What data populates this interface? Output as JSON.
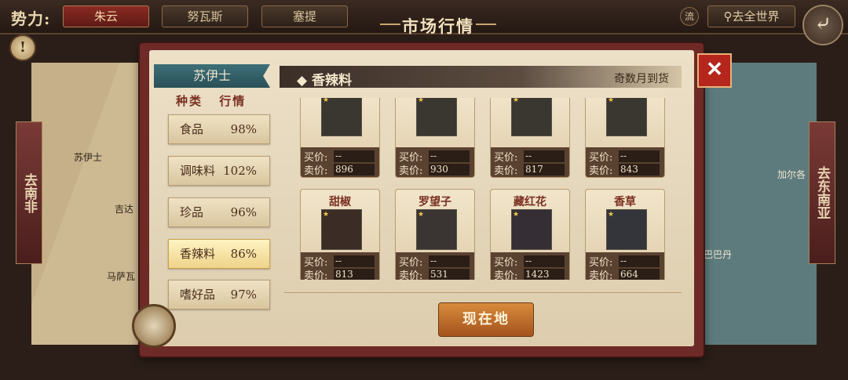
{
  "topbar": {
    "faction_label": "势力:",
    "factions": [
      "朱云",
      "努瓦斯",
      "塞提"
    ],
    "stream_label": "流",
    "world_button": "去全世界",
    "back_icon": "back-arrow-icon"
  },
  "title": "市场行情",
  "map": {
    "left_region": "去南非",
    "right_region": "去东南亚",
    "labels": [
      "苏伊士",
      "吉达",
      "马萨瓦",
      "加尔各",
      "巴巴丹"
    ]
  },
  "market": {
    "port": "苏伊士",
    "col_type": "种类",
    "col_trend": "行情",
    "categories": [
      {
        "name": "食品",
        "pct": "98%"
      },
      {
        "name": "调味料",
        "pct": "102%"
      },
      {
        "name": "珍品",
        "pct": "96%"
      },
      {
        "name": "香辣料",
        "pct": "86%"
      },
      {
        "name": "嗜好品",
        "pct": "97%"
      }
    ],
    "selected_index": 3,
    "header_title": "香辣料",
    "header_note": "奇数月到货",
    "buy_label": "买价:",
    "sell_label": "卖价:",
    "goods": [
      {
        "name": "",
        "buy": "--",
        "sell": "896"
      },
      {
        "name": "",
        "buy": "--",
        "sell": "930"
      },
      {
        "name": "",
        "buy": "--",
        "sell": "817"
      },
      {
        "name": "",
        "buy": "--",
        "sell": "843"
      },
      {
        "name": "甜椒",
        "buy": "--",
        "sell": "813"
      },
      {
        "name": "罗望子",
        "buy": "--",
        "sell": "531"
      },
      {
        "name": "藏红花",
        "buy": "--",
        "sell": "1423"
      },
      {
        "name": "香草",
        "buy": "--",
        "sell": "664"
      }
    ],
    "here_button": "现在地"
  },
  "colors": {
    "accent_red": "#b5261c",
    "banner_teal": "#3d6f78",
    "button_orange": "#c06a2a"
  }
}
